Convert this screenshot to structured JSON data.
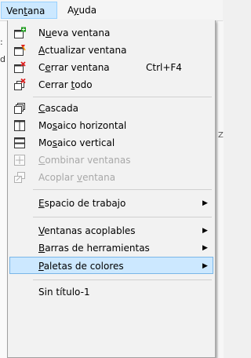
{
  "menubar": {
    "active_menu": {
      "before": "Ven",
      "u": "t",
      "after": "ana"
    },
    "other_menu": {
      "before": "A",
      "u": "y",
      "after": "uda"
    }
  },
  "background": {
    "left_fragments": [
      ":",
      "d"
    ],
    "right_fragment": "Z"
  },
  "menu": {
    "items": [
      {
        "before": "N",
        "u": "u",
        "after": "eva ventana",
        "icon": "new-window-icon",
        "enabled": true
      },
      {
        "before": "",
        "u": "A",
        "after": "ctualizar ventana",
        "icon": "refresh-window-icon",
        "enabled": true
      },
      {
        "before": "C",
        "u": "e",
        "after": "rrar ventana",
        "shortcut": "Ctrl+F4",
        "icon": "close-window-icon",
        "enabled": true
      },
      {
        "before": "Cerrar ",
        "u": "t",
        "after": "odo",
        "icon": "close-all-icon",
        "enabled": true
      },
      {
        "before": "",
        "u": "C",
        "after": "ascada",
        "icon": "cascade-icon",
        "enabled": true
      },
      {
        "before": "Mo",
        "u": "s",
        "after": "aico horizontal",
        "icon": "tile-horizontal-icon",
        "enabled": true
      },
      {
        "before": "Mo",
        "u": "s",
        "after": "aico vertical",
        "icon": "tile-vertical-icon",
        "enabled": true
      },
      {
        "before": "",
        "u": "C",
        "after": "ombinar ventanas",
        "icon": "combine-windows-icon",
        "enabled": false
      },
      {
        "before": "Acoplar ",
        "u": "v",
        "after": "entana",
        "icon": "dock-window-icon",
        "enabled": false
      },
      {
        "before": "",
        "u": "E",
        "after": "spacio de trabajo",
        "submenu": true,
        "enabled": true
      },
      {
        "before": "",
        "u": "V",
        "after": "entanas acoplables",
        "submenu": true,
        "enabled": true
      },
      {
        "before": "",
        "u": "B",
        "after": "arras de herramientas",
        "submenu": true,
        "enabled": true
      },
      {
        "before": "",
        "u": "P",
        "after": "aletas de colores",
        "submenu": true,
        "enabled": true,
        "highlighted": true
      },
      {
        "label": "Sin título-1",
        "enabled": true
      }
    ],
    "submenu_arrow": "▶"
  },
  "colors": {
    "menu_bg": "#f2f2f2",
    "highlight_bg": "#cce8ff",
    "highlight_border": "#7ab6e8",
    "disabled_text": "#a8a8a8",
    "icon_red": "#e02020",
    "icon_green": "#1a9a1a",
    "icon_orange": "#f29400"
  }
}
